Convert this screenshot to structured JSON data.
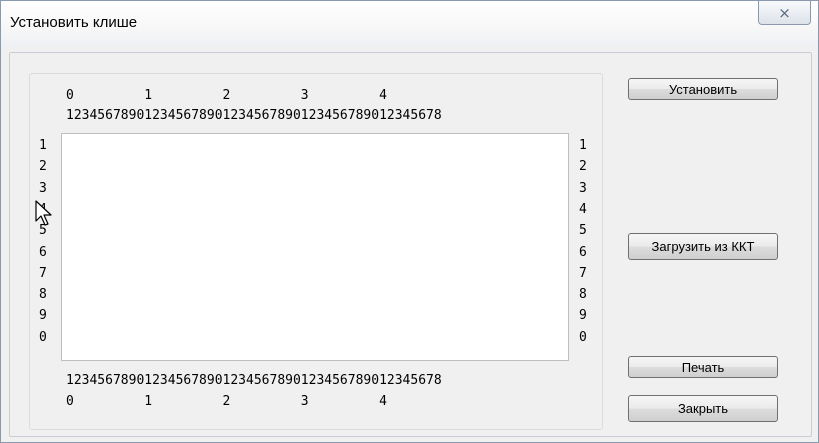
{
  "window": {
    "title": "Установить клише",
    "close_glyph": "⨯"
  },
  "ruler": {
    "top_tens": "0         1         2         3         4",
    "top_units": "12345678901234567890123456789012345678901234567 8",
    "bottom_units": "12345678901234567890123456789012345678901234567 8",
    "bottom_tens": "0         1         2         3         4",
    "left_rows": [
      "1",
      "2",
      "3",
      "4",
      "5",
      "6",
      "7",
      "8",
      "9",
      "0"
    ],
    "right_rows": [
      "1",
      "2",
      "3",
      "4",
      "5",
      "6",
      "7",
      "8",
      "9",
      "0"
    ]
  },
  "buttons": {
    "set": "Установить",
    "load": "Загрузить из ККТ",
    "print": "Печать",
    "close": "Закрыть"
  }
}
